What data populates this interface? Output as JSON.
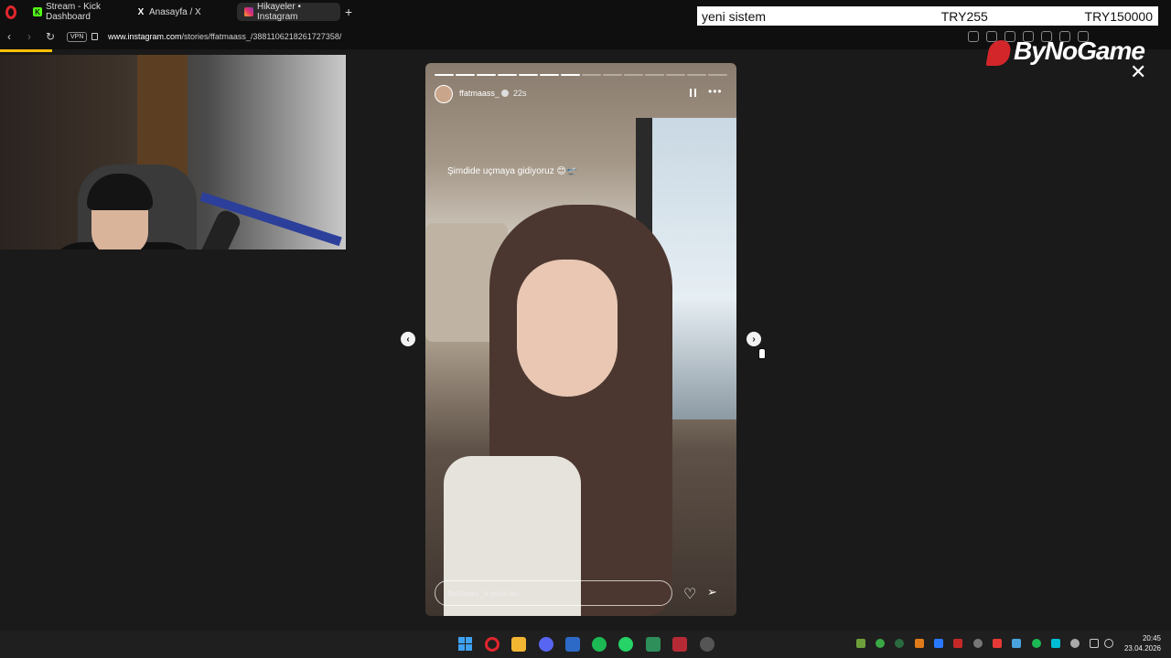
{
  "browser": {
    "tabs": [
      {
        "label": "Stream - Kick Dashboard",
        "icon": "kick-icon",
        "color": "#53fc18"
      },
      {
        "label": "Anasayfa / X",
        "icon": "x-icon",
        "color": "#ffffff"
      },
      {
        "label": "Hikayeler • Instagram",
        "icon": "instagram-icon",
        "color": "#e1306c"
      }
    ],
    "new_tab": "+",
    "tab_close": "×",
    "vpn": "VPN",
    "url_domain": "www.instagram.com",
    "url_path": "/stories/ffatmaass_/3881106218261727358/",
    "nav_back": "‹",
    "nav_forward": "›",
    "nav_reload": "↻"
  },
  "banner": {
    "title": "yeni sistem",
    "item1": "TRY255",
    "item2": "TRY150000"
  },
  "brand": {
    "name": "ByNoGame",
    "color": "#d3262b"
  },
  "story": {
    "username": "ffatmaass_",
    "time": "22s",
    "caption": "Şimdide uçmaya gidiyoruz 😊🛫",
    "reply_placeholder": "ffatmaass_'e yanıt ver...",
    "more": "•••",
    "heart": "♡",
    "send": "➢",
    "segments": 14,
    "segments_done": 7
  },
  "controls": {
    "prev": "‹",
    "next": "›",
    "close": "✕"
  },
  "taskbar": {
    "time": "20:45",
    "date": "23.04.2026"
  }
}
